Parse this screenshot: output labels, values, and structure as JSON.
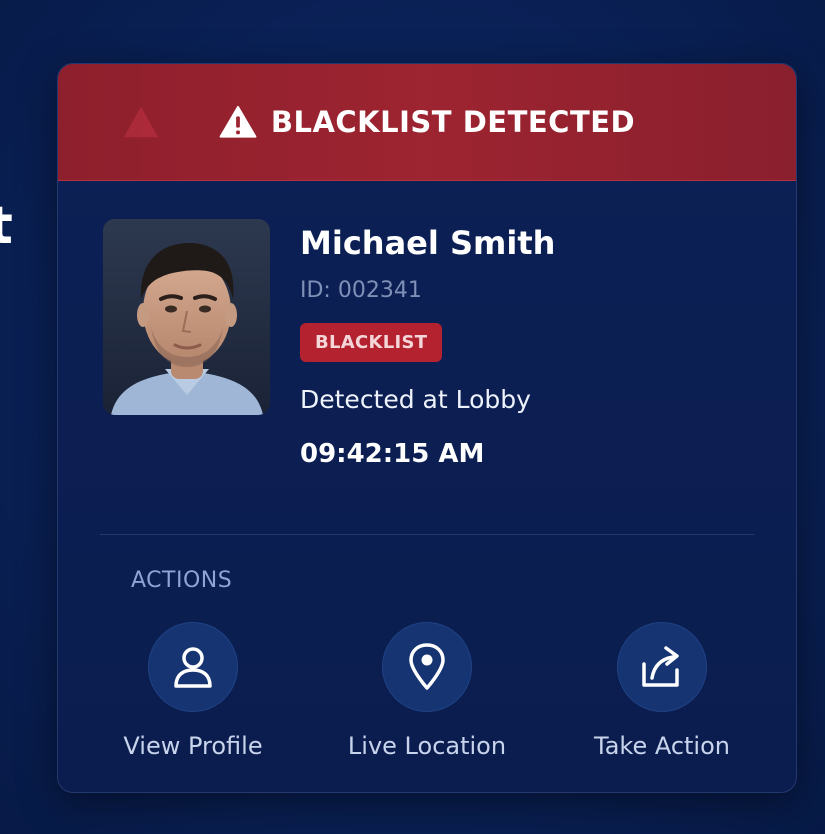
{
  "page": {
    "edge_glyph": "t"
  },
  "alert": {
    "title": "BLACKLIST DETECTED",
    "icon": "warning-triangle-icon",
    "color": "#9d2431"
  },
  "person": {
    "name": "Michael Smith",
    "id": "ID: 002341",
    "badge": "BLACKLIST",
    "badge_color": "#b3222e",
    "location": "Detected at Lobby",
    "time": "09:42:15 AM"
  },
  "actions": {
    "heading": "ACTIONS",
    "items": [
      {
        "label": "View Profile",
        "icon": "user-icon"
      },
      {
        "label": "Live Location",
        "icon": "map-pin-icon"
      },
      {
        "label": "Take Action",
        "icon": "export-action-icon"
      }
    ]
  }
}
